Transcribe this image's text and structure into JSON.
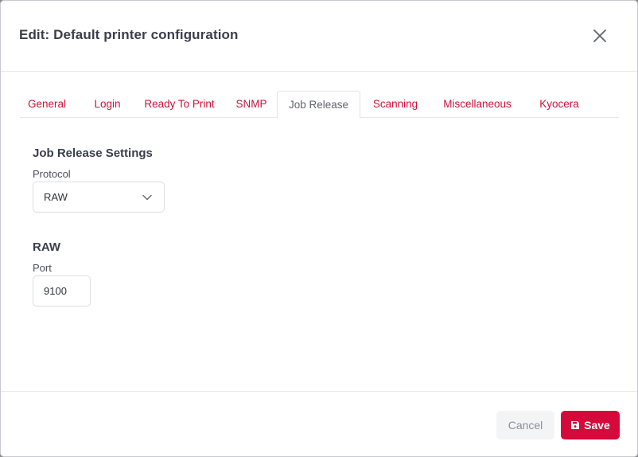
{
  "dialog": {
    "title": "Edit: Default printer configuration",
    "close_icon": "close-icon"
  },
  "tabs": [
    {
      "label": "General",
      "active": false
    },
    {
      "label": "Login",
      "active": false
    },
    {
      "label": "Ready To Print",
      "active": false
    },
    {
      "label": "SNMP",
      "active": false
    },
    {
      "label": "Job Release",
      "active": true
    },
    {
      "label": "Scanning",
      "active": false
    },
    {
      "label": "Miscellaneous",
      "active": false
    },
    {
      "label": "Kyocera",
      "active": false
    }
  ],
  "job_release": {
    "section_title": "Job Release Settings",
    "protocol_label": "Protocol",
    "protocol_value": "RAW",
    "protocol_icon": "chevron-down-icon"
  },
  "raw": {
    "section_title": "RAW",
    "port_label": "Port",
    "port_value": "9100"
  },
  "footer": {
    "cancel_label": "Cancel",
    "save_label": "Save",
    "save_icon": "floppy-disk-icon"
  },
  "colors": {
    "accent": "#d5093a",
    "tab_link": "#d0103a",
    "title_text": "#3a3e4c",
    "border": "#dcdee3"
  }
}
